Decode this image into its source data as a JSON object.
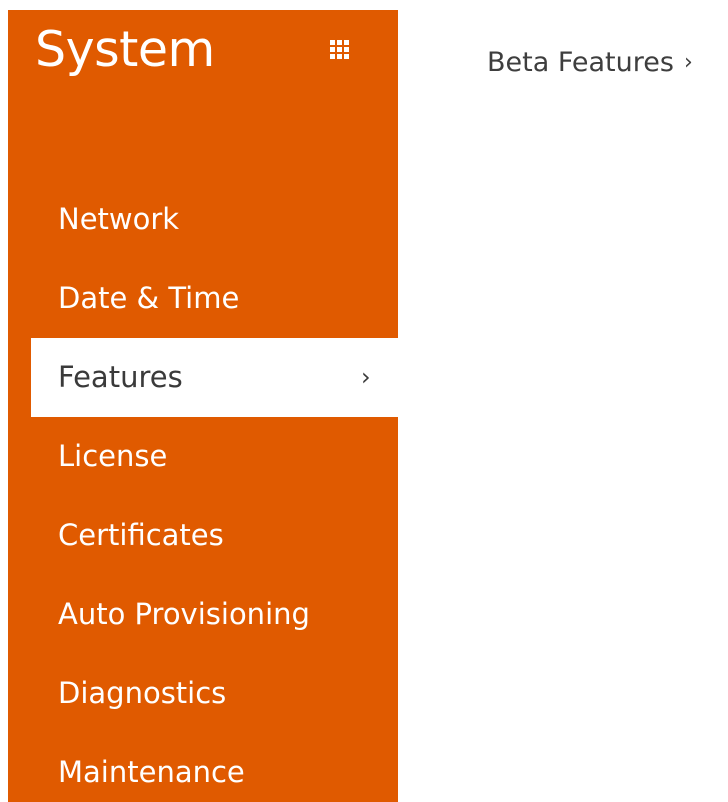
{
  "sidebar": {
    "title": "System",
    "grid_icon": "grid-menu-icon",
    "items": [
      {
        "label": "Network",
        "active": false
      },
      {
        "label": "Date & Time",
        "active": false
      },
      {
        "label": "Features",
        "active": true,
        "chevron": "›"
      },
      {
        "label": "License",
        "active": false
      },
      {
        "label": "Certificates",
        "active": false
      },
      {
        "label": "Auto Provisioning",
        "active": false
      },
      {
        "label": "Diagnostics",
        "active": false
      },
      {
        "label": "Maintenance",
        "active": false
      }
    ]
  },
  "content": {
    "beta_link": {
      "label": "Beta Features",
      "chevron": "›"
    }
  },
  "colors": {
    "sidebar_bg": "#e05a00",
    "sidebar_text": "#ffffff",
    "active_bg": "#ffffff",
    "active_text": "#3a3a3a",
    "content_text": "#3e3e3e"
  }
}
